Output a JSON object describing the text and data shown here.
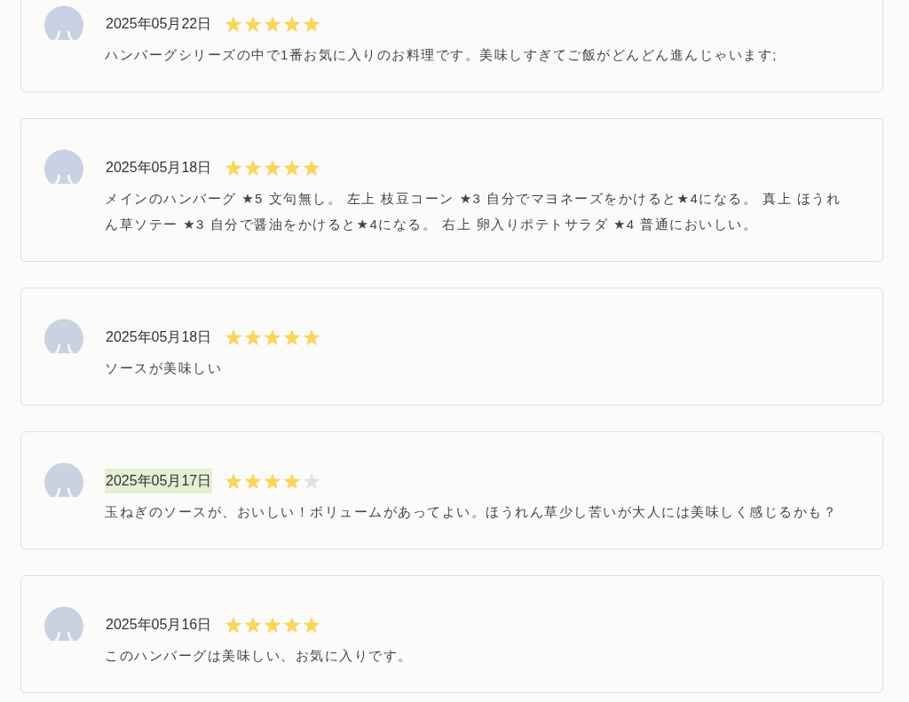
{
  "reviews": [
    {
      "date": "2025年05月22日",
      "date_highlighted": false,
      "stars": 5,
      "comment": "ハンバーグシリーズの中で1番お気に入りのお料理です。美味しすぎてご飯がどんどん進んじゃいます;"
    },
    {
      "date": "2025年05月18日",
      "date_highlighted": false,
      "stars": 5,
      "comment": "メインのハンバーグ ★5 文句無し。 左上 枝豆コーン ★3 自分でマヨネーズをかけると★4になる。 真上 ほうれん草ソテー ★3 自分で醤油をかけると★4になる。 右上 卵入りポテトサラダ ★4 普通においしい。"
    },
    {
      "date": "2025年05月18日",
      "date_highlighted": false,
      "stars": 5,
      "comment": "ソースが美味しい"
    },
    {
      "date": "2025年05月17日",
      "date_highlighted": true,
      "stars": 4,
      "comment": "玉ねぎのソースが、おいしい！ボリュームがあってよい。ほうれん草少し苦いが大人には美味しく感じるかも？"
    },
    {
      "date": "2025年05月16日",
      "date_highlighted": false,
      "stars": 5,
      "comment": "このハンバーグは美味しい、お気に入りです。"
    }
  ]
}
